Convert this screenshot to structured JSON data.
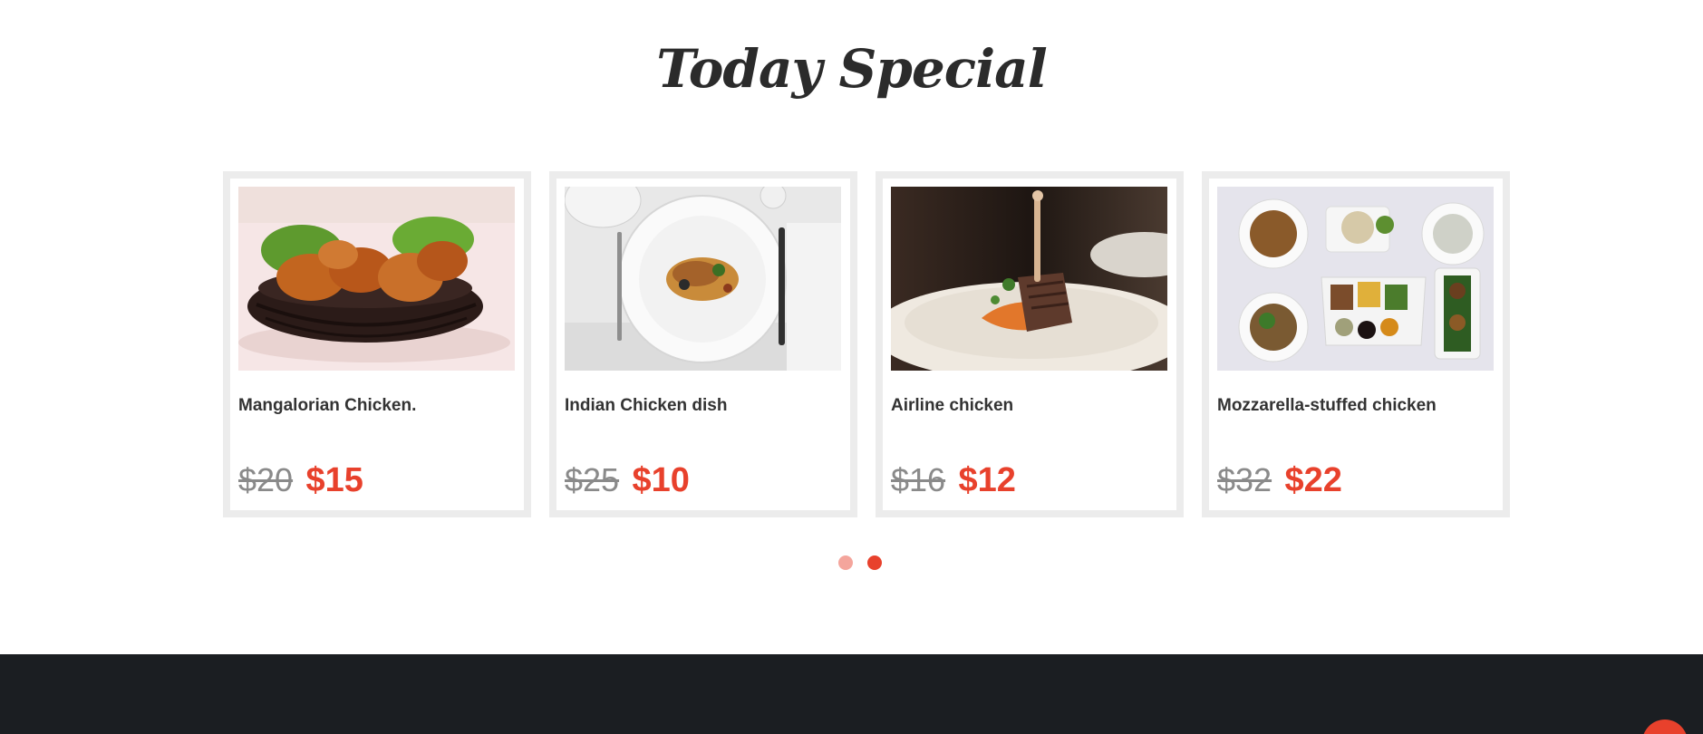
{
  "section": {
    "title": "Today Special"
  },
  "dishes": [
    {
      "name": "Mangalorian Chicken.",
      "old_price": "$20",
      "new_price": "$15"
    },
    {
      "name": "Indian Chicken dish",
      "old_price": "$25",
      "new_price": "$10"
    },
    {
      "name": "Airline chicken",
      "old_price": "$16",
      "new_price": "$12"
    },
    {
      "name": "Mozzarella-stuffed chicken",
      "old_price": "$32",
      "new_price": "$22"
    }
  ],
  "carousel": {
    "page_count": 2,
    "active_page": 2
  },
  "colors": {
    "accent": "#e8412c",
    "dot_inactive": "#f4a59c",
    "footer_bg": "#1b1e22",
    "card_border": "#ececec"
  }
}
